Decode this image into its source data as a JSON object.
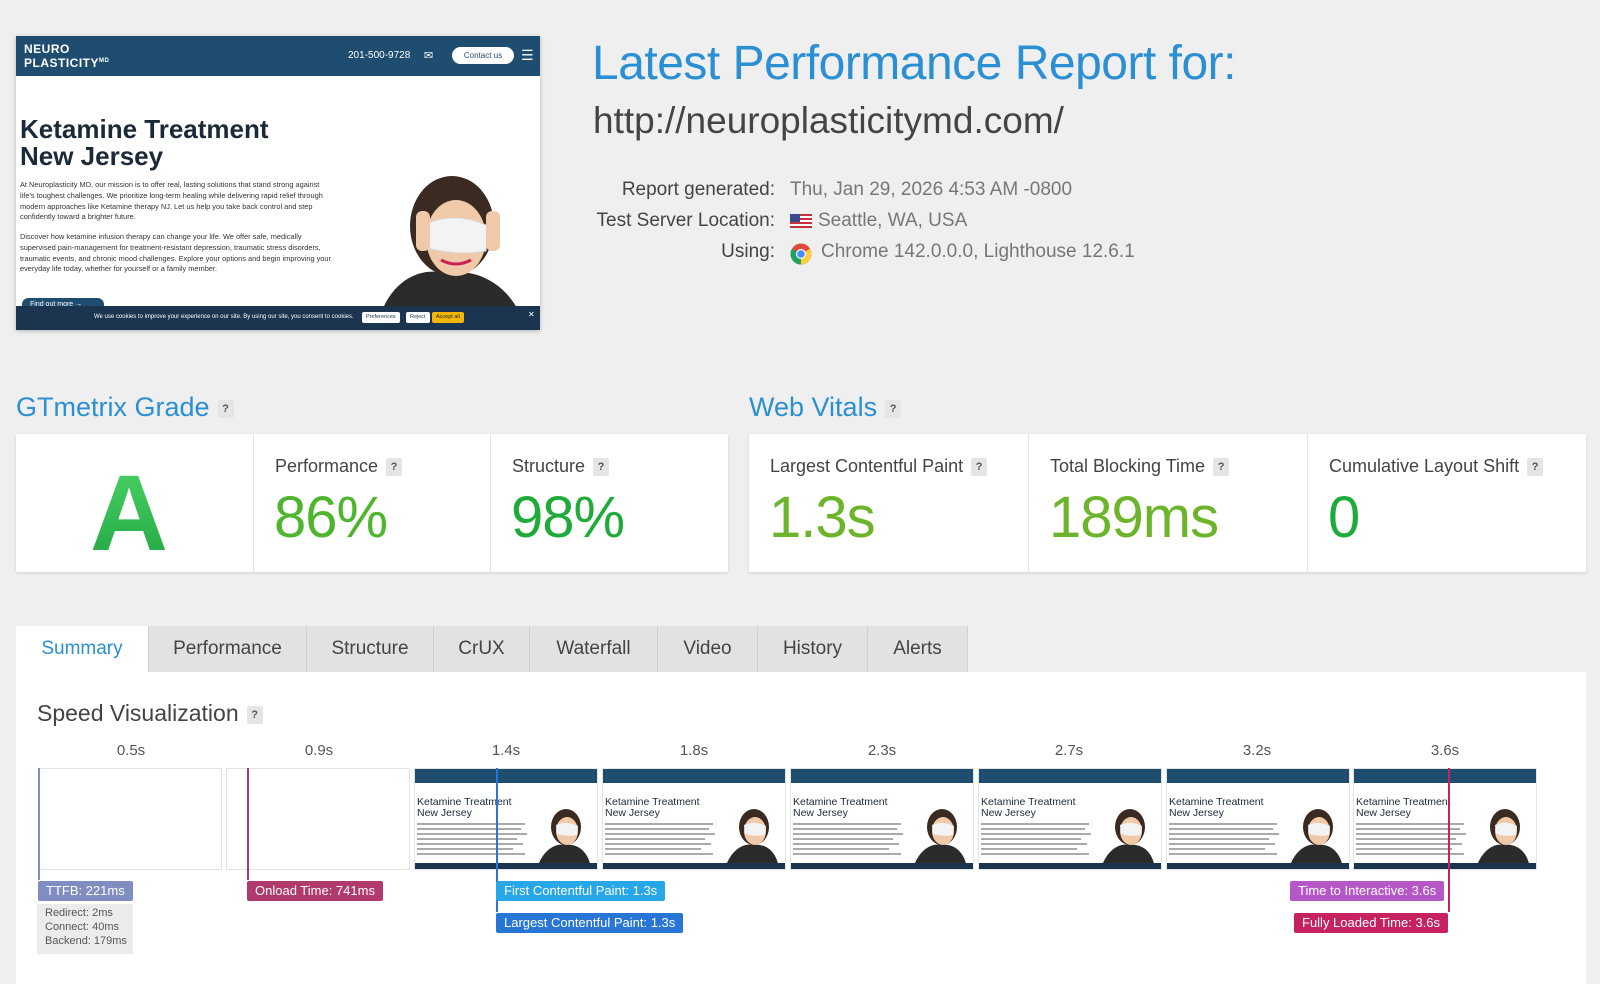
{
  "preview": {
    "logo": "NEURO PLASTICITY",
    "logo_sup": "MD",
    "phone": "201-500-9728",
    "contact_label": "Contact us",
    "heading": "Ketamine Treatment New Jersey",
    "paragraph1": "At Neuroplasticity MD, our mission is to offer real, lasting solutions that stand strong against life's toughest challenges. We prioritize long-term healing while delivering rapid relief through modern approaches like Ketamine therapy NJ. Let us help you take back control and step confidently toward a brighter future.",
    "paragraph2": "Discover how ketamine infusion therapy can change your life. We offer safe, medically supervised pain-management for treatment-resistant depression, traumatic stress disorders, traumatic events, and chronic mood challenges. Explore your options and begin improving your everyday life today, whether for yourself or a family member.",
    "cta": "Find out more →",
    "cookie_text": "We use cookies to improve your experience on our site. By using our site, you consent to cookies.",
    "cookie_preferences": "Preferences",
    "cookie_reject": "Reject",
    "cookie_accept": "Accept all"
  },
  "report": {
    "title": "Latest Performance Report for:",
    "url": "http://neuroplasticitymd.com/",
    "generated_label": "Report generated:",
    "generated_value": "Thu, Jan 29, 2026 4:53 AM -0800",
    "location_label": "Test Server Location:",
    "location_value": "Seattle, WA, USA",
    "using_label": "Using:",
    "using_value": "Chrome 142.0.0.0, Lighthouse 12.6.1"
  },
  "grade": {
    "section_title": "GTmetrix Grade",
    "letter": "A",
    "performance_label": "Performance",
    "performance_value": "86%",
    "structure_label": "Structure",
    "structure_value": "98%"
  },
  "vitals": {
    "section_title": "Web Vitals",
    "lcp_label": "Largest Contentful Paint",
    "lcp_value": "1.3s",
    "tbt_label": "Total Blocking Time",
    "tbt_value": "189ms",
    "cls_label": "Cumulative Layout Shift",
    "cls_value": "0"
  },
  "tabs": [
    "Summary",
    "Performance",
    "Structure",
    "CrUX",
    "Waterfall",
    "Video",
    "History",
    "Alerts"
  ],
  "speed": {
    "title": "Speed Visualization",
    "ticks": [
      "0.5s",
      "0.9s",
      "1.4s",
      "1.8s",
      "2.3s",
      "2.7s",
      "3.2s",
      "3.6s"
    ],
    "frame_title": "Ketamine Treatment New Jersey",
    "ttfb": "TTFB: 221ms",
    "redirect": "Redirect: 2ms",
    "connect": "Connect: 40ms",
    "backend": "Backend: 179ms",
    "onload": "Onload Time: 741ms",
    "fcp": "First Contentful Paint: 1.3s",
    "lcp": "Largest Contentful Paint: 1.3s",
    "tti": "Time to Interactive: 3.6s",
    "fully_loaded": "Fully Loaded Time: 3.6s"
  },
  "colors": {
    "accent": "#2a8fd3",
    "grade_green": "#27b049",
    "perf_green": "#4fb52e",
    "structure_green": "#1fab3a",
    "lcp_green": "#6cb52a",
    "tbt_green": "#6cb52a",
    "cls_green": "#1fab3a",
    "ttfb": "#7f8dc0",
    "onload": "#b03a6e",
    "fcp": "#27a7e8",
    "lcp_marker": "#2776d6",
    "tti": "#b557c7",
    "fully_loaded": "#c62160"
  },
  "icons": [
    "help-icon",
    "us-flag-icon",
    "chrome-icon",
    "mail-icon",
    "menu-icon"
  ]
}
